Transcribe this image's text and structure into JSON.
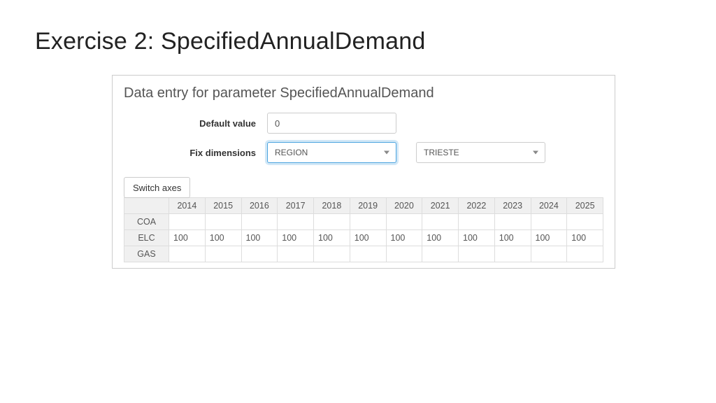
{
  "title": "Exercise 2: SpecifiedAnnualDemand",
  "panel": {
    "heading": "Data entry for parameter SpecifiedAnnualDemand",
    "default_value_label": "Default value",
    "default_value_input": "0",
    "fix_dimensions_label": "Fix dimensions",
    "dimension_select_1": "REGION",
    "dimension_select_2": "TRIESTE",
    "switch_axes_label": "Switch axes"
  },
  "table": {
    "columns": [
      "2014",
      "2015",
      "2016",
      "2017",
      "2018",
      "2019",
      "2020",
      "2021",
      "2022",
      "2023",
      "2024",
      "2025"
    ],
    "rows": [
      {
        "name": "COA",
        "values": [
          "",
          "",
          "",
          "",
          "",
          "",
          "",
          "",
          "",
          "",
          "",
          ""
        ]
      },
      {
        "name": "ELC",
        "values": [
          "100",
          "100",
          "100",
          "100",
          "100",
          "100",
          "100",
          "100",
          "100",
          "100",
          "100",
          "100"
        ]
      },
      {
        "name": "GAS",
        "values": [
          "",
          "",
          "",
          "",
          "",
          "",
          "",
          "",
          "",
          "",
          "",
          ""
        ]
      }
    ]
  }
}
